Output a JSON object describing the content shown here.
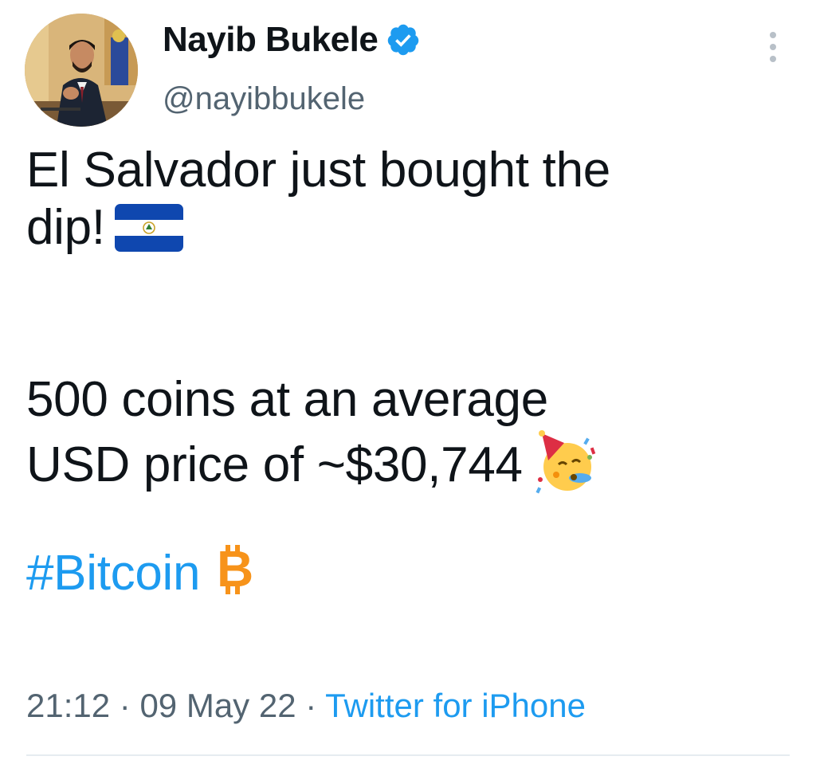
{
  "author": {
    "display_name": "Nayib Bukele",
    "handle": "@nayibbukele",
    "verified": true,
    "avatar_icon": "profile-photo"
  },
  "tweet": {
    "line1": "El Salvador just bought the",
    "line2": "dip!",
    "flag_emoji": "el-salvador-flag-icon",
    "line3": "500 coins at an average",
    "line4": "USD price of ~$30,744",
    "party_emoji": "partying-face-icon",
    "hashtag": "#Bitcoin",
    "bitcoin_emoji": "bitcoin-icon"
  },
  "meta": {
    "time": "21:12",
    "sep1": "·",
    "date": "09 May 22",
    "sep2": "·",
    "source": "Twitter for iPhone"
  },
  "colors": {
    "link": "#1d9bf0",
    "secondary_text": "#536471",
    "text": "#0f1419",
    "verified_badge": "#1d9bf0",
    "bitcoin_orange": "#f7931a"
  }
}
